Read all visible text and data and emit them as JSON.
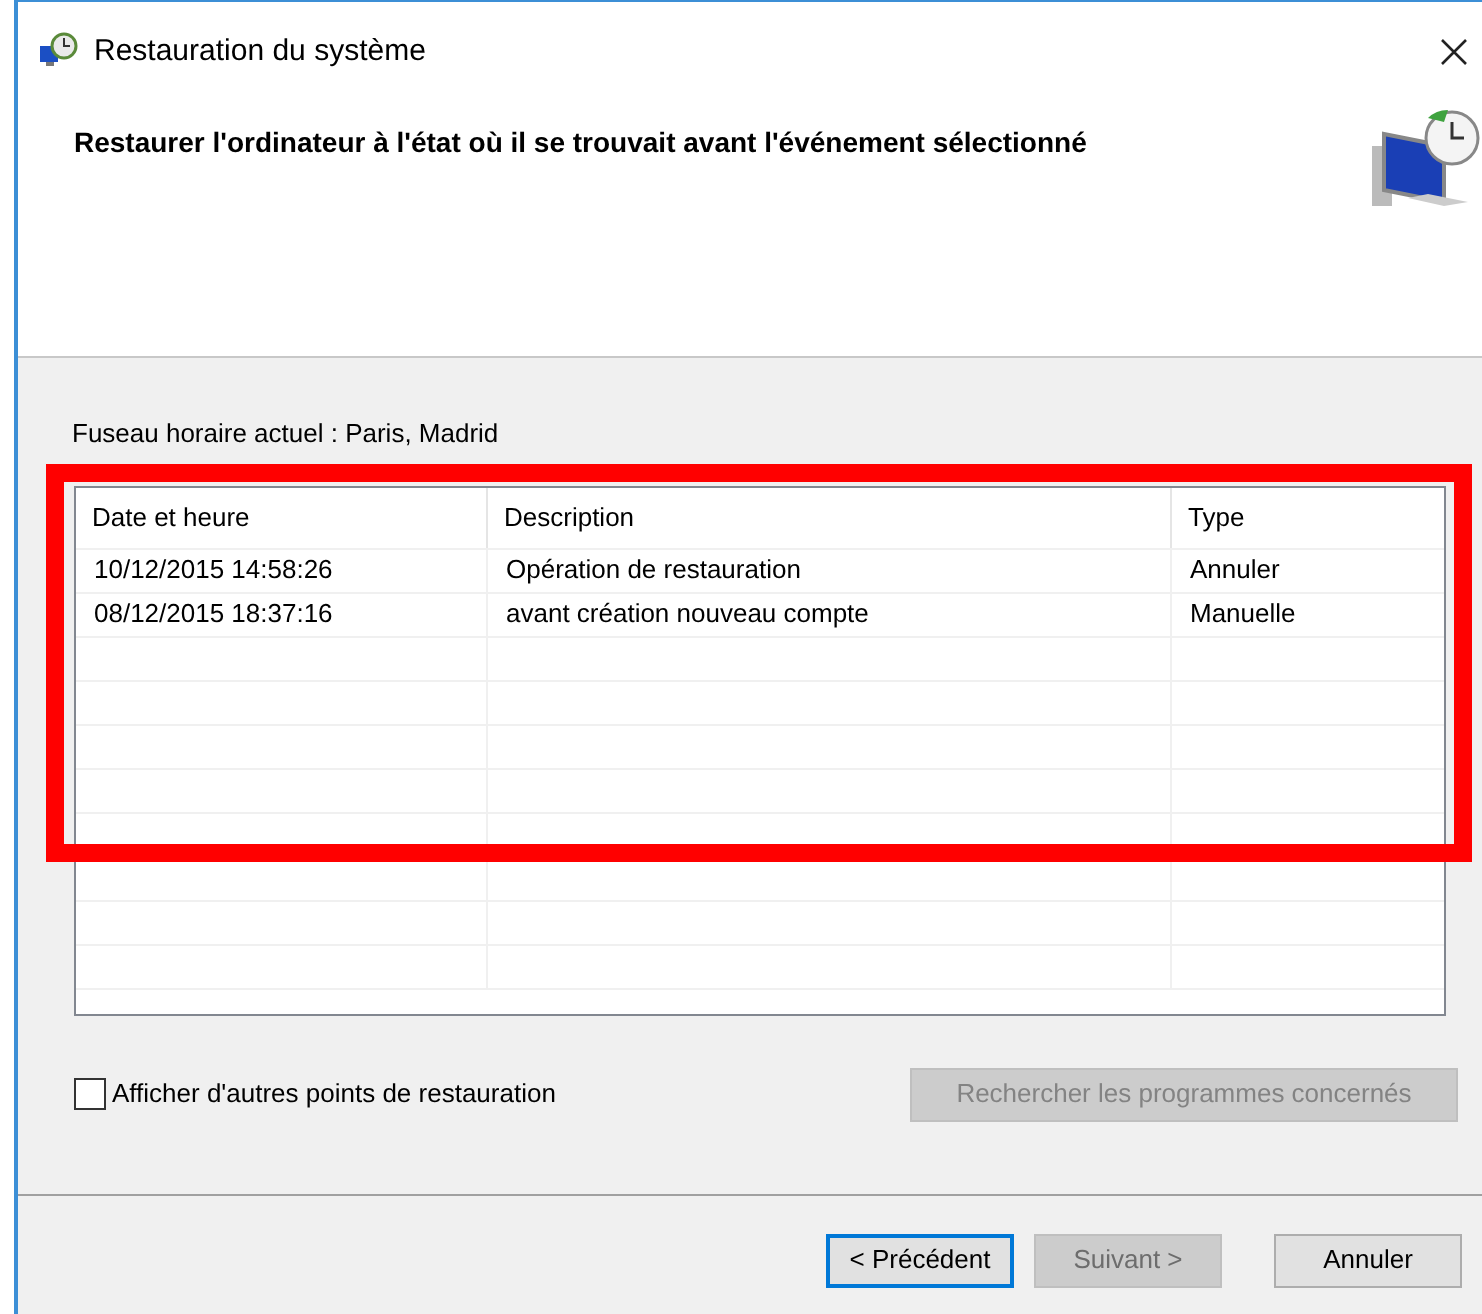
{
  "window": {
    "title": "Restauration du système"
  },
  "header": {
    "heading": "Restaurer l'ordinateur à l'état où il se trouvait avant l'événement sélectionné"
  },
  "timezone": "Fuseau horaire actuel : Paris, Madrid",
  "table": {
    "columns": [
      "Date et heure",
      "Description",
      "Type"
    ],
    "rows": [
      [
        "10/12/2015 14:58:26",
        "Opération de restauration",
        "Annuler"
      ],
      [
        "08/12/2015 18:37:16",
        "avant création nouveau compte",
        "Manuelle"
      ]
    ]
  },
  "show_more": {
    "label": "Afficher d'autres points de restauration",
    "checked": false
  },
  "scan_button": {
    "label": "Rechercher les programmes concernés",
    "disabled": true
  },
  "buttons": [
    {
      "label": "< Précédent",
      "disabled": false,
      "focused": true
    },
    {
      "label": "Suivant >",
      "disabled": true,
      "focused": false
    },
    {
      "label": "Annuler",
      "disabled": false,
      "focused": false
    }
  ]
}
